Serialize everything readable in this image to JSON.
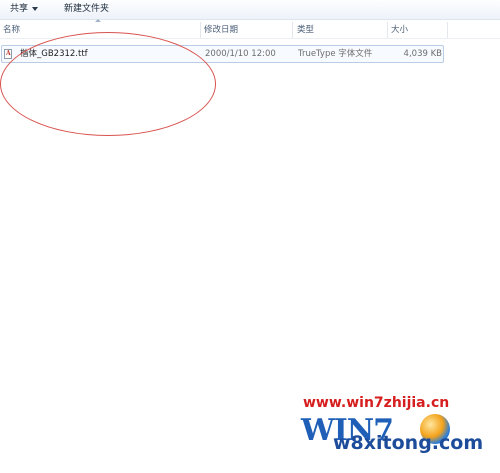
{
  "toolbar": {
    "share_label": "共享",
    "new_folder_label": "新建文件夹"
  },
  "columns": {
    "name": "名称",
    "date": "修改日期",
    "type": "类型",
    "size": "大小"
  },
  "files": [
    {
      "name": "楷体_GB2312.ttf",
      "modified": "2000/1/10 12:00",
      "type": "TrueType 字体文件",
      "size": "4,039 KB",
      "icon": "font-file-icon"
    }
  ],
  "watermark": {
    "url": "www.win7zhijia.cn",
    "logo_text": "WIN7",
    "site": "w8xitong.com"
  },
  "colors": {
    "annotation": "#d9534f",
    "selection_border": "#b9cde5",
    "watermark_red": "#d61e1e",
    "watermark_blue": "#1f5fb7"
  }
}
